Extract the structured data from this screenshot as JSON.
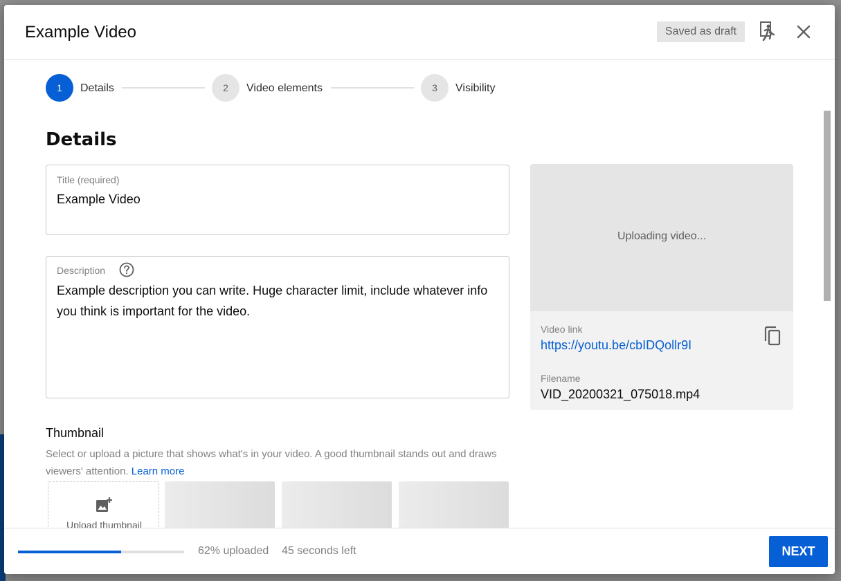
{
  "dialog": {
    "title": "Example Video",
    "draft_status": "Saved as draft",
    "feedback_icon": "feedback-icon",
    "close_icon": "close-icon"
  },
  "stepper": [
    {
      "number": "1",
      "label": "Details",
      "active": true
    },
    {
      "number": "2",
      "label": "Video elements",
      "active": false
    },
    {
      "number": "3",
      "label": "Visibility",
      "active": false
    }
  ],
  "details": {
    "heading": "Details",
    "title_field": {
      "label": "Title (required)",
      "value": "Example Video"
    },
    "description_field": {
      "label": "Description",
      "value": "Example description you can write. Huge character limit, include whatever info you think is important for the video.",
      "help_icon": "help-circle-icon"
    }
  },
  "thumbnail": {
    "heading": "Thumbnail",
    "description": "Select or upload a picture that shows what's in your video. A good thumbnail stands out and draws viewers' attention.",
    "learn_more": "Learn more",
    "upload_label": "Upload thumbnail",
    "upload_icon": "add-photo-icon"
  },
  "preview": {
    "status": "Uploading video...",
    "link_label": "Video link",
    "link": "https://youtu.be/cbIDQollr9I",
    "filename_label": "Filename",
    "filename": "VID_20200321_075018.mp4",
    "copy_icon": "copy-icon"
  },
  "footer": {
    "progress_fraction": 0.62,
    "uploaded_text": "62% uploaded",
    "time_left": "45 seconds left",
    "next_label": "NEXT"
  },
  "colors": {
    "accent": "#065fd4",
    "text": "#0d0d0d",
    "muted": "#808080"
  }
}
